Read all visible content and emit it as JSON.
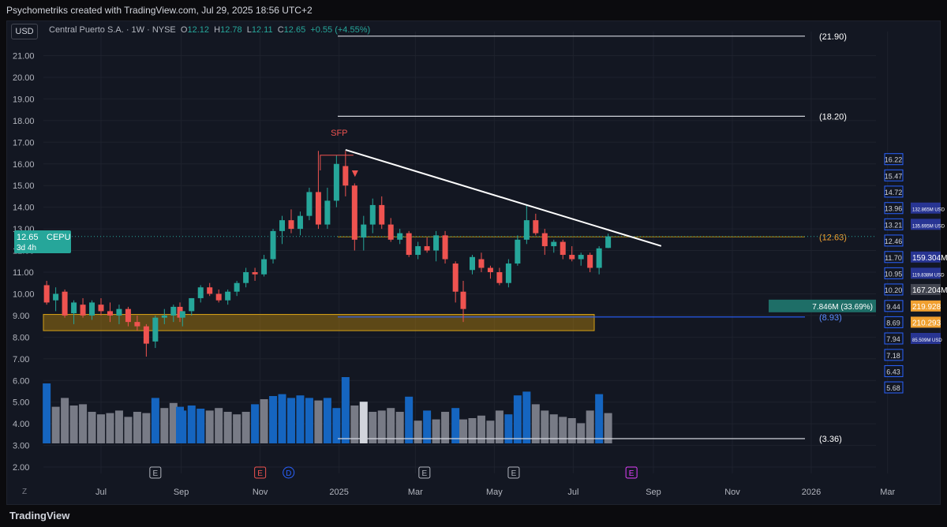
{
  "header": {
    "credit": "Psychometriks created with TradingView.com, Jul 29, 2025 18:56 UTC+2",
    "currency": "USD"
  },
  "legend": {
    "symbol": "Central Puerto S.A. · 1W · NYSE",
    "o_label": "O",
    "o": "12.12",
    "h_label": "H",
    "h": "12.78",
    "l_label": "L",
    "l": "12.11",
    "c_label": "C",
    "c": "12.65",
    "change": "+0.55 (+4.55%)"
  },
  "price_tag": {
    "price": "12.65",
    "ticker": "CEPU",
    "countdown": "3d 4h"
  },
  "footer": {
    "logo": "TradingView",
    "zoom": "Z"
  },
  "colors": {
    "up": "#26a69a",
    "down": "#ef5350",
    "background": "#131722",
    "grid": "#1e222d",
    "vol_blue": "#1565c0",
    "vol_gray": "#787b86",
    "zone": "#b8860b"
  },
  "chart_data": {
    "type": "candlestick",
    "y_axis": {
      "range": [
        1.6,
        21.8
      ],
      "ticks": [
        "21.00",
        "20.00",
        "19.00",
        "18.00",
        "17.00",
        "16.00",
        "15.00",
        "14.00",
        "13.00",
        "12.00",
        "11.00",
        "10.00",
        "9.00",
        "8.00",
        "7.00",
        "6.00",
        "5.00",
        "4.00",
        "3.00",
        "2.00"
      ]
    },
    "x_axis": {
      "range": [
        "2025-05-19",
        "2026-04-06"
      ],
      "ticks": [
        {
          "label": "Jul",
          "date": "2024-07-01"
        },
        {
          "label": "Sep",
          "date": "2024-09-01"
        },
        {
          "label": "Nov",
          "date": "2024-11-01"
        },
        {
          "label": "2025",
          "date": "2025-01-01"
        },
        {
          "label": "Mar",
          "date": "2025-03-01"
        },
        {
          "label": "May",
          "date": "2025-05-01"
        },
        {
          "label": "Jul",
          "date": "2025-07-01"
        },
        {
          "label": "Sep",
          "date": "2025-09-01"
        },
        {
          "label": "Nov",
          "date": "2025-11-01"
        },
        {
          "label": "2026",
          "date": "2026-01-01"
        },
        {
          "label": "Mar",
          "date": "2026-03-01"
        }
      ]
    },
    "ohlc": [
      [
        "2024-05-20",
        10.4,
        10.6,
        9.5,
        9.6
      ],
      [
        "2024-05-27",
        9.7,
        10.3,
        9.2,
        10.0
      ],
      [
        "2024-06-03",
        10.1,
        10.2,
        8.9,
        9.0
      ],
      [
        "2024-06-10",
        9.1,
        9.7,
        8.6,
        9.6
      ],
      [
        "2024-06-17",
        9.5,
        9.8,
        8.9,
        9.0
      ],
      [
        "2024-06-24",
        9.0,
        9.7,
        8.8,
        9.6
      ],
      [
        "2024-07-01",
        9.5,
        9.8,
        9.0,
        9.2
      ],
      [
        "2024-07-08",
        9.2,
        9.6,
        8.7,
        9.0
      ],
      [
        "2024-07-15",
        9.0,
        9.5,
        8.6,
        9.3
      ],
      [
        "2024-07-22",
        9.3,
        9.4,
        8.5,
        8.7
      ],
      [
        "2024-07-29",
        8.7,
        9.0,
        8.3,
        8.5
      ],
      [
        "2024-08-05",
        8.5,
        8.6,
        7.1,
        7.7
      ],
      [
        "2024-08-12",
        7.8,
        9.0,
        7.5,
        8.9
      ],
      [
        "2024-08-19",
        8.9,
        9.3,
        8.6,
        9.0
      ],
      [
        "2024-08-26",
        9.0,
        9.5,
        8.7,
        9.4
      ],
      [
        "2024-08-31",
        9.4,
        9.6,
        8.7,
        8.9
      ],
      [
        "2024-09-02",
        8.9,
        9.2,
        8.5,
        9.2
      ],
      [
        "2024-09-09",
        9.2,
        9.8,
        9.0,
        9.8
      ],
      [
        "2024-09-16",
        9.8,
        10.4,
        9.6,
        10.3
      ],
      [
        "2024-09-23",
        10.3,
        10.5,
        9.9,
        10.0
      ],
      [
        "2024-09-30",
        10.0,
        10.2,
        9.6,
        9.7
      ],
      [
        "2024-10-07",
        9.7,
        10.2,
        9.5,
        10.1
      ],
      [
        "2024-10-14",
        10.1,
        10.6,
        9.9,
        10.5
      ],
      [
        "2024-10-21",
        10.5,
        11.2,
        10.3,
        11.0
      ],
      [
        "2024-10-28",
        11.0,
        11.2,
        10.6,
        10.9
      ],
      [
        "2024-11-04",
        10.9,
        11.8,
        10.8,
        11.6
      ],
      [
        "2024-11-11",
        11.6,
        13.0,
        11.4,
        12.9
      ],
      [
        "2024-11-18",
        12.9,
        13.6,
        12.3,
        13.4
      ],
      [
        "2024-11-25",
        13.4,
        13.9,
        12.8,
        13.0
      ],
      [
        "2024-12-02",
        13.0,
        13.8,
        12.7,
        13.6
      ],
      [
        "2024-12-09",
        13.6,
        14.9,
        13.4,
        14.7
      ],
      [
        "2024-12-16",
        14.7,
        16.6,
        13.0,
        13.2
      ],
      [
        "2024-12-23",
        13.2,
        14.9,
        13.0,
        14.3
      ],
      [
        "2024-12-30",
        14.3,
        16.4,
        14.0,
        16.0
      ],
      [
        "2025-01-06",
        15.9,
        16.6,
        14.5,
        15.0
      ],
      [
        "2025-01-13",
        15.0,
        15.1,
        12.0,
        12.5
      ],
      [
        "2025-01-20",
        12.6,
        13.6,
        12.0,
        13.2
      ],
      [
        "2025-01-27",
        13.2,
        14.4,
        12.8,
        14.1
      ],
      [
        "2025-02-03",
        14.1,
        14.5,
        13.0,
        13.2
      ],
      [
        "2025-02-10",
        13.2,
        13.5,
        12.4,
        12.5
      ],
      [
        "2025-02-17",
        12.5,
        13.0,
        12.3,
        12.8
      ],
      [
        "2025-02-24",
        12.8,
        12.9,
        11.7,
        11.8
      ],
      [
        "2025-03-03",
        11.8,
        12.4,
        11.6,
        12.2
      ],
      [
        "2025-03-10",
        12.2,
        12.6,
        11.9,
        12.0
      ],
      [
        "2025-03-17",
        12.0,
        12.9,
        11.5,
        12.7
      ],
      [
        "2025-03-24",
        12.7,
        12.9,
        11.4,
        11.6
      ],
      [
        "2025-04-01",
        11.4,
        11.5,
        9.6,
        10.1
      ],
      [
        "2025-04-07",
        10.1,
        10.6,
        8.7,
        9.3
      ],
      [
        "2025-04-14",
        11.1,
        11.8,
        10.9,
        11.7
      ],
      [
        "2025-04-21",
        11.6,
        11.9,
        11.0,
        11.2
      ],
      [
        "2025-04-28",
        11.2,
        11.3,
        10.7,
        11.0
      ],
      [
        "2025-05-05",
        11.0,
        11.2,
        10.4,
        10.5
      ],
      [
        "2025-05-12",
        10.5,
        11.6,
        10.3,
        11.4
      ],
      [
        "2025-05-19",
        11.4,
        12.7,
        11.3,
        12.5
      ],
      [
        "2025-05-26",
        12.5,
        14.1,
        12.3,
        13.4
      ],
      [
        "2025-06-02",
        13.4,
        13.7,
        12.7,
        12.8
      ],
      [
        "2025-06-09",
        12.8,
        13.0,
        11.8,
        12.2
      ],
      [
        "2025-06-16",
        12.2,
        12.5,
        11.9,
        12.4
      ],
      [
        "2025-06-23",
        12.4,
        12.5,
        11.6,
        11.8
      ],
      [
        "2025-06-30",
        11.8,
        12.2,
        11.5,
        11.6
      ],
      [
        "2025-07-07",
        11.6,
        11.9,
        11.3,
        11.8
      ],
      [
        "2025-07-14",
        11.8,
        11.9,
        11.0,
        11.2
      ],
      [
        "2025-07-21",
        11.2,
        12.2,
        10.9,
        12.1
      ],
      [
        "2025-07-28",
        12.12,
        12.78,
        12.11,
        12.65
      ]
    ],
    "volume_relative": [
      0.95,
      0.58,
      0.72,
      0.6,
      0.62,
      0.5,
      0.46,
      0.48,
      0.52,
      0.42,
      0.5,
      0.48,
      0.72,
      0.56,
      0.64,
      0.58,
      0.52,
      0.6,
      0.55,
      0.52,
      0.56,
      0.5,
      0.46,
      0.5,
      0.62,
      0.7,
      0.75,
      0.78,
      0.72,
      0.76,
      0.72,
      0.68,
      0.72,
      0.56,
      1.05,
      0.6,
      0.66,
      0.5,
      0.52,
      0.56,
      0.5,
      0.74,
      0.36,
      0.52,
      0.38,
      0.5,
      0.56,
      0.38,
      0.4,
      0.44,
      0.36,
      0.52,
      0.46,
      0.76,
      0.82,
      0.62,
      0.52,
      0.46,
      0.42,
      0.4,
      0.32,
      0.52,
      0.78,
      0.48,
      0.5,
      0.14
    ],
    "volume_colors": [
      "blue",
      "gray",
      "gray",
      "gray",
      "gray",
      "gray",
      "gray",
      "gray",
      "gray",
      "gray",
      "gray",
      "gray",
      "blue",
      "gray",
      "gray",
      "blue",
      "blue",
      "blue",
      "blue",
      "gray",
      "gray",
      "gray",
      "gray",
      "gray",
      "blue",
      "gray",
      "blue",
      "blue",
      "blue",
      "blue",
      "blue",
      "gray",
      "blue",
      "blue",
      "blue",
      "gray",
      "white",
      "gray",
      "gray",
      "gray",
      "gray",
      "blue",
      "gray",
      "blue",
      "gray",
      "gray",
      "blue",
      "gray",
      "gray",
      "gray",
      "gray",
      "gray",
      "blue",
      "blue",
      "blue",
      "gray",
      "gray",
      "gray",
      "gray",
      "gray",
      "gray",
      "gray",
      "blue",
      "gray",
      "gray",
      "gray"
    ],
    "levels": [
      {
        "value": 21.9,
        "label": "(21.90)"
      },
      {
        "value": 18.2,
        "label": "(18.20)"
      },
      {
        "value": 12.63,
        "label": "(12.63)"
      },
      {
        "value": 8.93,
        "label": "(8.93)"
      },
      {
        "value": 3.36,
        "label": "(3.36)"
      }
    ],
    "trendline": {
      "from": [
        "2025-01-06",
        16.65
      ],
      "to": [
        "2025-09-07",
        12.21
      ]
    },
    "sfp_label": "SFP",
    "demand_zone": {
      "from": "2024-05-20",
      "to": "2025-07-28",
      "low": 8.3,
      "high": 9.05
    },
    "events": [
      {
        "date": "2024-08-12",
        "label": "E"
      },
      {
        "date": "2024-11-01",
        "label": "E"
      },
      {
        "date": "2024-11-23",
        "label": "D"
      },
      {
        "date": "2025-03-08",
        "label": "E"
      },
      {
        "date": "2025-05-16",
        "label": "E"
      },
      {
        "date": "2025-08-15",
        "label": "E"
      }
    ],
    "profile": {
      "price_levels": [
        "16.22",
        "15.47",
        "14.72",
        "13.96",
        "13.21",
        "12.46",
        "11.70",
        "10.95",
        "10.20",
        "9.44",
        "8.69",
        "7.94",
        "7.18",
        "6.43",
        "5.68"
      ],
      "right_values": [
        "",
        "",
        "",
        "132.865M USD",
        "135.695M USD",
        "",
        "159.304M",
        "119.838M USD",
        "167.204M",
        "219.928",
        "210.293",
        "85.509M USD",
        "",
        "",
        "",
        ""
      ],
      "highlight": "7.846M (33.69%)"
    }
  }
}
